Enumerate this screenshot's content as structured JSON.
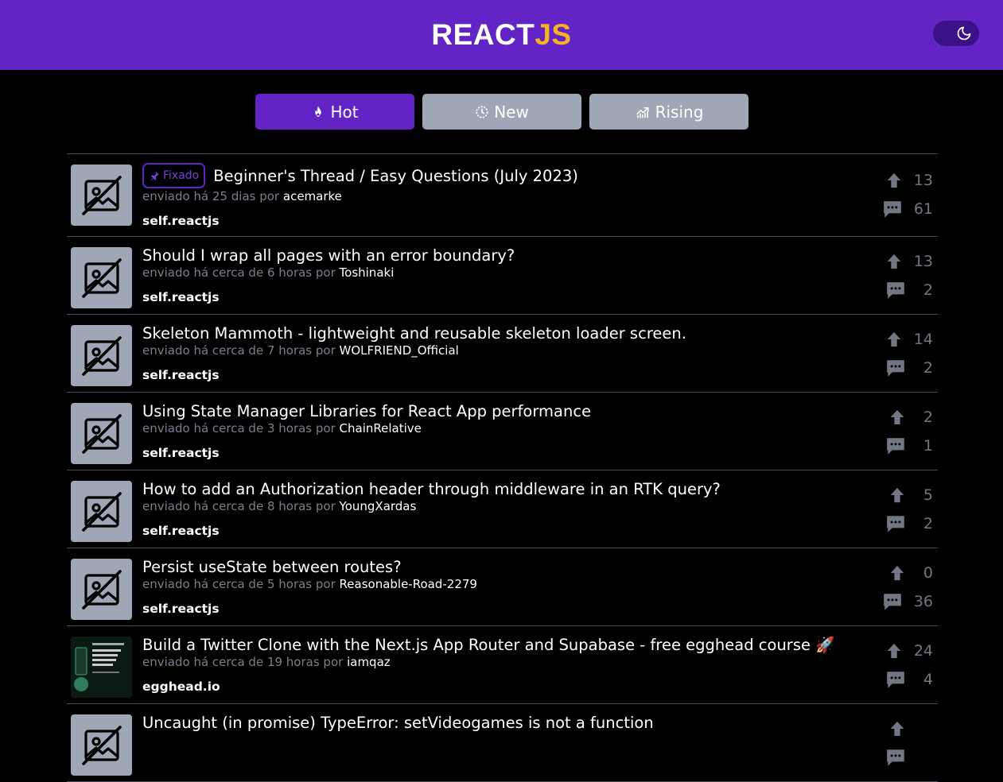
{
  "header": {
    "logo_main": "REACT",
    "logo_accent": "JS"
  },
  "tabs": [
    {
      "label": "Hot",
      "icon": "flame-icon",
      "active": true
    },
    {
      "label": "New",
      "icon": "clock-icon",
      "active": false
    },
    {
      "label": "Rising",
      "icon": "trending-up-icon",
      "active": false
    }
  ],
  "pinned_label": "Fixado",
  "posts": [
    {
      "title": "Beginner's Thread / Easy Questions (July 2023)",
      "time": "enviado há 25 dias por",
      "author": "acemarke",
      "domain": "self.reactjs",
      "upvotes": "13",
      "comments": "61",
      "pinned": true
    },
    {
      "title": "Should I wrap all pages with an error boundary?",
      "time": "enviado há cerca de 6 horas por",
      "author": "Toshinaki",
      "domain": "self.reactjs",
      "upvotes": "13",
      "comments": "2"
    },
    {
      "title": "Skeleton Mammoth - lightweight and reusable skeleton loader screen.",
      "time": "enviado há cerca de 7 horas por",
      "author": "WOLFRIEND_Official",
      "domain": "self.reactjs",
      "upvotes": "14",
      "comments": "2"
    },
    {
      "title": "Using State Manager Libraries for React App performance",
      "time": "enviado há cerca de 3 horas por",
      "author": "ChainRelative",
      "domain": "self.reactjs",
      "upvotes": "2",
      "comments": "1"
    },
    {
      "title": "How to add an Authorization header through middleware in an RTK query?",
      "time": "enviado há cerca de 8 horas por",
      "author": "YoungXardas",
      "domain": "self.reactjs",
      "upvotes": "5",
      "comments": "2"
    },
    {
      "title": "Persist useState between routes?",
      "time": "enviado há cerca de 5 horas por",
      "author": "Reasonable-Road-2279",
      "domain": "self.reactjs",
      "upvotes": "0",
      "comments": "36"
    },
    {
      "title": "Build a Twitter Clone with the Next.js App Router and Supabase - free egghead course 🚀",
      "time": "enviado há cerca de 19 horas por",
      "author": "iamqaz",
      "domain": "egghead.io",
      "upvotes": "24",
      "comments": "4",
      "has_image": true
    },
    {
      "title": "Uncaught (in promise) TypeError: setVideogames is not a function",
      "time": "",
      "author": "",
      "domain": "",
      "upvotes": "",
      "comments": ""
    }
  ]
}
